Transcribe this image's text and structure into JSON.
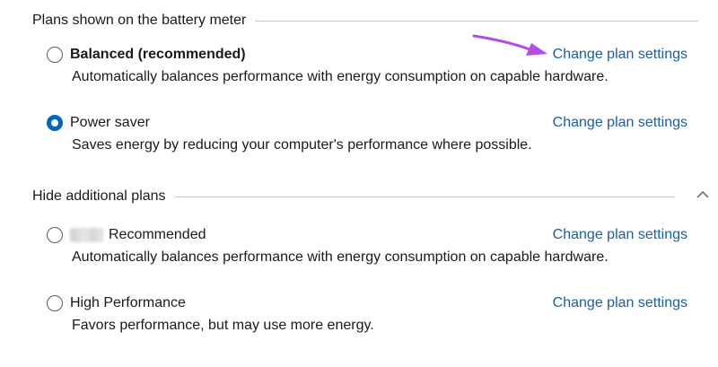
{
  "battery_section": {
    "header": "Plans shown on the battery meter",
    "plans": [
      {
        "name": "Balanced (recommended)",
        "selected": false,
        "link": "Change plan settings",
        "description": "Automatically balances performance with energy consumption on capable hardware."
      },
      {
        "name": "Power saver",
        "selected": true,
        "link": "Change plan settings",
        "description": "Saves energy by reducing your computer's performance where possible."
      }
    ]
  },
  "additional_section": {
    "header": "Hide additional plans",
    "plans": [
      {
        "name": "Recommended",
        "selected": false,
        "link": "Change plan settings",
        "description": "Automatically balances performance with energy consumption on capable hardware."
      },
      {
        "name": "High Performance",
        "selected": false,
        "link": "Change plan settings",
        "description": "Favors performance, but may use more energy."
      }
    ]
  },
  "colors": {
    "accent": "#0067c0",
    "link": "#1a5fa0",
    "annotation_arrow": "#b44ee0"
  },
  "icons": {
    "collapse": "chevron-up-icon",
    "annotation": "arrow-pointer-icon"
  }
}
